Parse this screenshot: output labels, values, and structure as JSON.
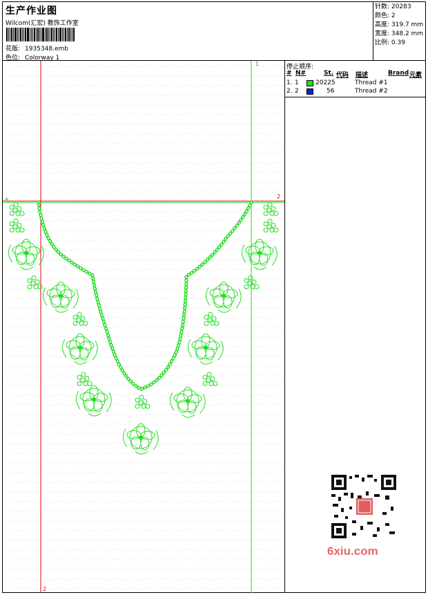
{
  "header": {
    "title": "生产作业图",
    "company": "Wilcom(汇宏) 教饰工作室",
    "design_label": "花版:",
    "design_value": "1935348.emb",
    "colorway_label": "色位:",
    "colorway_value": "Colorway 1"
  },
  "stats": [
    {
      "label": "针数:",
      "value": "20283"
    },
    {
      "label": "颜色:",
      "value": "2"
    },
    {
      "label": "高度:",
      "value": "319.7 mm"
    },
    {
      "label": "宽度:",
      "value": "348.2 mm"
    },
    {
      "label": "比例:",
      "value": "0.39"
    }
  ],
  "stop_sequence": {
    "title": "停止顺序:",
    "columns": [
      "#",
      "N#",
      "St.",
      "代码",
      "描述",
      "Brand",
      "元素"
    ],
    "rows": [
      {
        "index": "1.",
        "n": "1",
        "color": "#22dd22",
        "code": "20225",
        "desc": "Thread #1"
      },
      {
        "index": "2.",
        "n": "2",
        "color": "#1a1adf",
        "code": "56",
        "desc": "Thread #2"
      }
    ]
  },
  "markers": {
    "v1_top": "1",
    "h2_right": "2",
    "v2_bottom": "2",
    "origin_plus": "+"
  },
  "watermark": {
    "text": "6xiu.com"
  },
  "colors": {
    "thread1": "#22dd22",
    "guide_red": "#dd0000",
    "guide_green": "#22dd22"
  }
}
